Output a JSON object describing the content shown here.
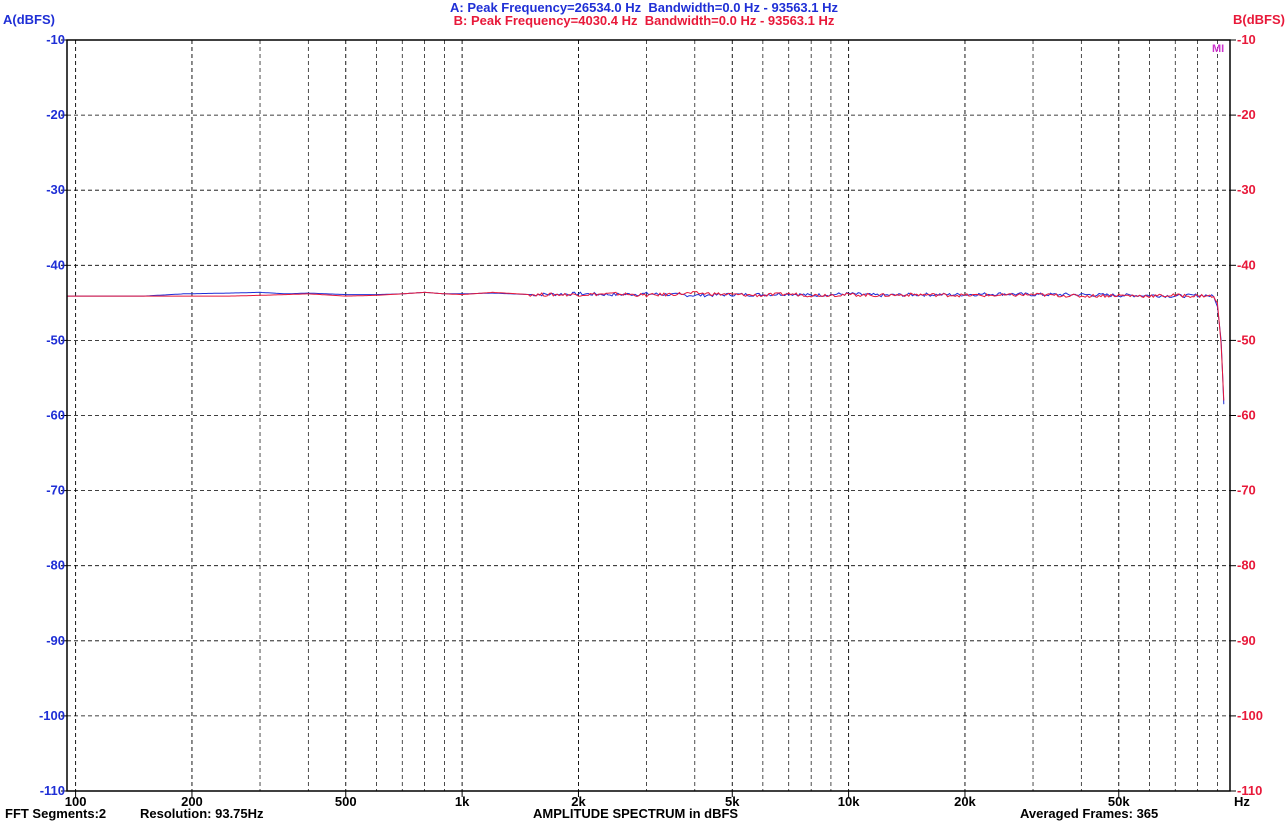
{
  "header": {
    "line_a": "A: Peak Frequency=26534.0 Hz  Bandwidth=0.0 Hz - 93563.1 Hz",
    "line_b": "B: Peak Frequency=4030.4 Hz  Bandwidth=0.0 Hz - 93563.1 Hz",
    "left_axis_title": "A(dBFS)",
    "right_axis_title": "B(dBFS)",
    "marker": "MI"
  },
  "footer": {
    "fft_segments": "FFT Segments:2",
    "resolution": "Resolution: 93.75Hz",
    "title": "AMPLITUDE SPECTRUM in dBFS",
    "averaged_frames": "Averaged Frames: 365"
  },
  "colors": {
    "series_a": "#1f2fd6",
    "series_b": "#e8193a",
    "left_axis_text": "#1f2fd6",
    "right_axis_text": "#e8193a",
    "header_a": "#1f2fd6",
    "header_b": "#e8193a",
    "marker": "#cc33cc"
  },
  "chart_data": {
    "type": "line",
    "title": "AMPLITUDE SPECTRUM in dBFS",
    "xscale": "log",
    "xlim": [
      95,
      97000
    ],
    "ylim": [
      -110,
      -10
    ],
    "xunit": "Hz",
    "ylabel_left": "A(dBFS)",
    "ylabel_right": "B(dBFS)",
    "grid": true,
    "x_ticks": [
      {
        "value": 100,
        "label": "100"
      },
      {
        "value": 200,
        "label": "200"
      },
      {
        "value": 500,
        "label": "500"
      },
      {
        "value": 1000,
        "label": "1k"
      },
      {
        "value": 2000,
        "label": "2k"
      },
      {
        "value": 5000,
        "label": "5k"
      },
      {
        "value": 10000,
        "label": "10k"
      },
      {
        "value": 20000,
        "label": "20k"
      },
      {
        "value": 50000,
        "label": "50k"
      }
    ],
    "x_minor_ticks": [
      300,
      400,
      600,
      700,
      800,
      900,
      3000,
      4000,
      6000,
      7000,
      8000,
      9000,
      30000,
      40000,
      60000,
      70000,
      80000,
      90000
    ],
    "y_ticks_left": [
      "-10",
      "-20",
      "-30",
      "-40",
      "-50",
      "-60",
      "-70",
      "-80",
      "-90",
      "-100",
      "-110"
    ],
    "y_ticks_right": [
      "-10",
      "-20",
      "-30",
      "-40",
      "-50",
      "-60",
      "-70",
      "-80",
      "-90",
      "-100",
      "-110"
    ],
    "y_tick_values": [
      -10,
      -20,
      -30,
      -40,
      -50,
      -60,
      -70,
      -80,
      -90,
      -100,
      -110
    ],
    "series": [
      {
        "name": "A",
        "x": [
          95,
          150,
          190,
          250,
          300,
          350,
          400,
          500,
          600,
          700,
          800,
          900,
          1000,
          1200,
          1500,
          2000,
          2500,
          3000,
          4000,
          5000,
          6000,
          7000,
          8000,
          10000,
          12000,
          15000,
          20000,
          25000,
          30000,
          40000,
          50000,
          60000,
          70000,
          80000,
          85000,
          88000,
          90000,
          92000,
          93500
        ],
        "y": [
          -44.1,
          -44.1,
          -43.8,
          -43.7,
          -43.6,
          -43.8,
          -43.7,
          -43.9,
          -43.9,
          -43.8,
          -43.6,
          -43.8,
          -43.8,
          -43.7,
          -43.9,
          -43.8,
          -43.9,
          -43.8,
          -44.0,
          -43.9,
          -43.9,
          -43.8,
          -44.0,
          -43.8,
          -44.0,
          -43.9,
          -43.9,
          -43.8,
          -43.9,
          -43.9,
          -44.0,
          -44.0,
          -44.1,
          -44.0,
          -44.0,
          -44.2,
          -45.5,
          -50.0,
          -58.5
        ]
      },
      {
        "name": "B",
        "x": [
          95,
          150,
          190,
          250,
          300,
          350,
          400,
          500,
          600,
          700,
          800,
          900,
          1000,
          1200,
          1500,
          2000,
          2500,
          3000,
          4000,
          5000,
          6000,
          7000,
          8000,
          10000,
          12000,
          15000,
          20000,
          25000,
          30000,
          40000,
          50000,
          60000,
          70000,
          80000,
          85000,
          88000,
          90000,
          92000,
          93500
        ],
        "y": [
          -44.1,
          -44.1,
          -44.1,
          -44.1,
          -44.0,
          -43.9,
          -43.8,
          -44.1,
          -44.0,
          -43.8,
          -43.6,
          -43.8,
          -43.9,
          -43.6,
          -43.9,
          -43.9,
          -43.8,
          -44.0,
          -43.7,
          -43.9,
          -44.0,
          -43.8,
          -44.0,
          -43.9,
          -44.0,
          -43.9,
          -44.0,
          -44.0,
          -43.9,
          -44.1,
          -44.0,
          -44.1,
          -44.0,
          -44.1,
          -44.0,
          -44.3,
          -45.0,
          -50.5,
          -58.0
        ]
      }
    ]
  }
}
